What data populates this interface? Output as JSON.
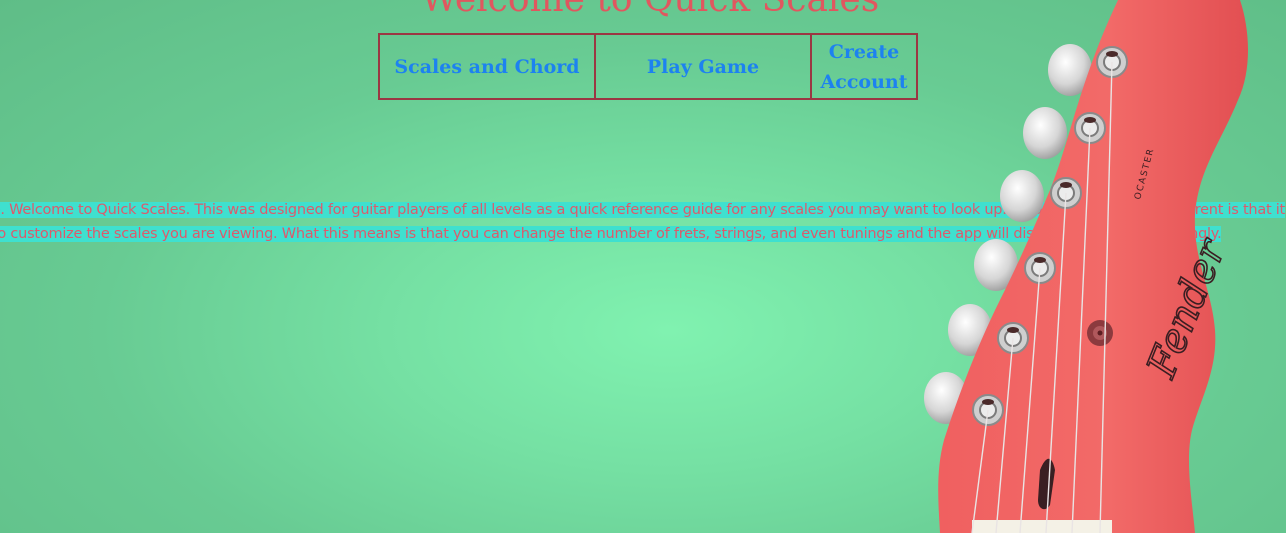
{
  "page": {
    "title": "Welcome to Quick Scales"
  },
  "nav": {
    "items": [
      {
        "label": "Scales and Chord"
      },
      {
        "label": "Play Game"
      },
      {
        "label": "Create Account"
      }
    ]
  },
  "intro": {
    "line1": "o. Welcome to Quick Scales. This was designed for guitar players of all levels as a quick reference guide for any scales you may want to look up. What makes this app different is that it",
    "line2": "to customize the scales you are viewing. What this means is that you can change the number of frets, strings, and even tunings and the app will display the notes accordingly."
  },
  "guitar": {
    "brand": "Fender",
    "model_text": "OCASTER",
    "body_color": "#ef5a5a"
  },
  "colors": {
    "title": "#e0575f",
    "nav_text": "#1d82f0",
    "nav_border": "#9b3743",
    "intro_text": "#dc5b6c",
    "intro_highlight": "#3fe0cf"
  }
}
